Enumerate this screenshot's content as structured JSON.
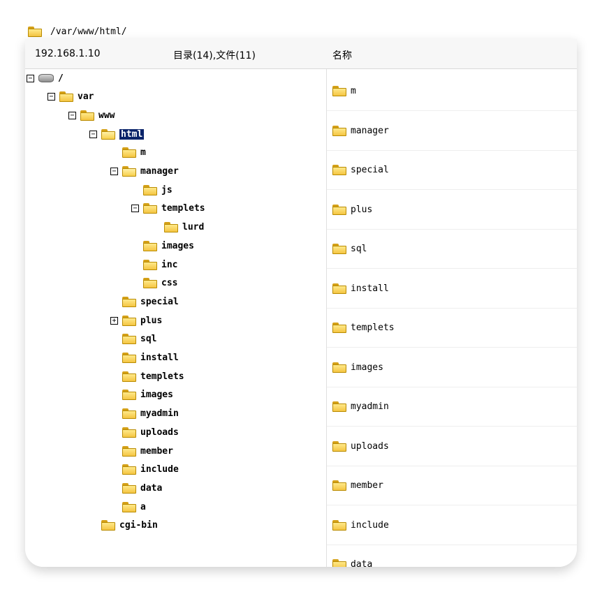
{
  "path_bar": {
    "path": "/var/www/html/"
  },
  "header": {
    "host": "192.168.1.10",
    "summary": "目录(14),文件(11)",
    "name_col": "名称"
  },
  "tree": [
    {
      "label": "/",
      "depth": 0,
      "toggle": "⊟",
      "icon": "drive-icon"
    },
    {
      "label": "var",
      "depth": 1,
      "toggle": "⊟",
      "icon": "folder-icon"
    },
    {
      "label": "www",
      "depth": 2,
      "toggle": "⊟",
      "icon": "folder-icon"
    },
    {
      "label": "html",
      "depth": 3,
      "toggle": "⊟",
      "icon": "open-folder-icon",
      "selected": true
    },
    {
      "label": "m",
      "depth": 4,
      "toggle": "",
      "icon": "folder-icon"
    },
    {
      "label": "manager",
      "depth": 4,
      "toggle": "⊟",
      "icon": "open-folder-icon"
    },
    {
      "label": "js",
      "depth": 5,
      "toggle": "",
      "icon": "folder-icon"
    },
    {
      "label": "templets",
      "depth": 5,
      "toggle": "⊟",
      "icon": "folder-icon"
    },
    {
      "label": "lurd",
      "depth": 6,
      "toggle": "",
      "icon": "folder-icon"
    },
    {
      "label": "images",
      "depth": 5,
      "toggle": "",
      "icon": "folder-icon"
    },
    {
      "label": "inc",
      "depth": 5,
      "toggle": "",
      "icon": "folder-icon"
    },
    {
      "label": "css",
      "depth": 5,
      "toggle": "",
      "icon": "folder-icon"
    },
    {
      "label": "special",
      "depth": 4,
      "toggle": "",
      "icon": "folder-icon"
    },
    {
      "label": "plus",
      "depth": 4,
      "toggle": "⊞",
      "icon": "folder-icon"
    },
    {
      "label": "sql",
      "depth": 4,
      "toggle": "",
      "icon": "folder-icon"
    },
    {
      "label": "install",
      "depth": 4,
      "toggle": "",
      "icon": "folder-icon"
    },
    {
      "label": "templets",
      "depth": 4,
      "toggle": "",
      "icon": "folder-icon"
    },
    {
      "label": "images",
      "depth": 4,
      "toggle": "",
      "icon": "folder-icon"
    },
    {
      "label": "myadmin",
      "depth": 4,
      "toggle": "",
      "icon": "folder-icon"
    },
    {
      "label": "uploads",
      "depth": 4,
      "toggle": "",
      "icon": "folder-icon"
    },
    {
      "label": "member",
      "depth": 4,
      "toggle": "",
      "icon": "folder-icon"
    },
    {
      "label": "include",
      "depth": 4,
      "toggle": "",
      "icon": "folder-icon"
    },
    {
      "label": "data",
      "depth": 4,
      "toggle": "",
      "icon": "folder-icon"
    },
    {
      "label": "a",
      "depth": 4,
      "toggle": "",
      "icon": "folder-icon"
    },
    {
      "label": "cgi-bin",
      "depth": 3,
      "toggle": "",
      "icon": "folder-icon"
    }
  ],
  "files": [
    "m",
    "manager",
    "special",
    "plus",
    "sql",
    "install",
    "templets",
    "images",
    "myadmin",
    "uploads",
    "member",
    "include",
    "data"
  ]
}
